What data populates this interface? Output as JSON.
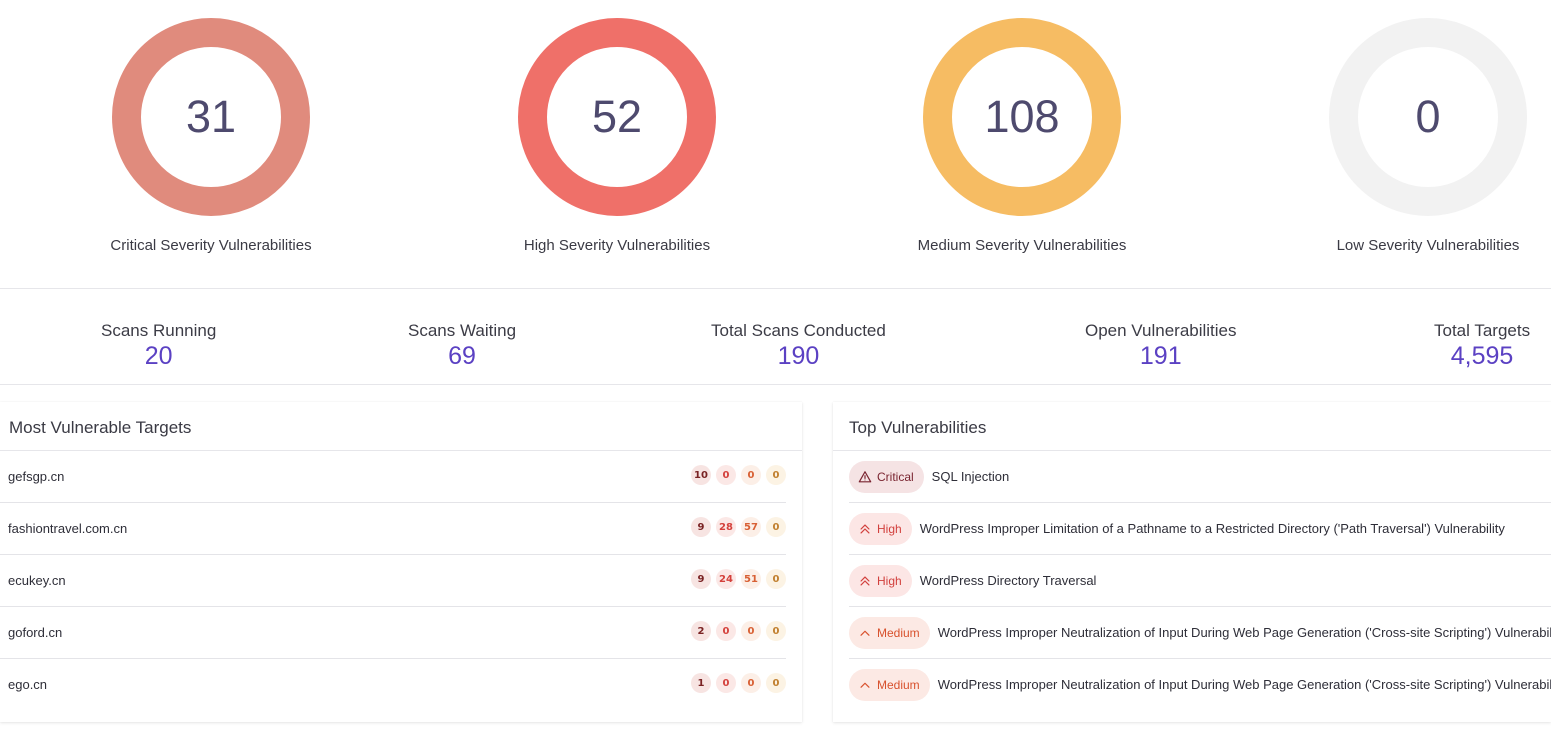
{
  "severity_cards": [
    {
      "value": "31",
      "label": "Critical Severity Vulnerabilities",
      "color": "#e08b7d"
    },
    {
      "value": "52",
      "label": "High Severity Vulnerabilities",
      "color": "#ef7069"
    },
    {
      "value": "108",
      "label": "Medium Severity Vulnerabilities",
      "color": "#f6bc63"
    },
    {
      "value": "0",
      "label": "Low Severity Vulnerabilities",
      "color": "#f2f2f2"
    }
  ],
  "stats": [
    {
      "label": "Scans Running",
      "value": "20"
    },
    {
      "label": "Scans Waiting",
      "value": "69"
    },
    {
      "label": "Total Scans Conducted",
      "value": "190"
    },
    {
      "label": "Open Vulnerabilities",
      "value": "191"
    },
    {
      "label": "Total Targets",
      "value": "4,595"
    }
  ],
  "most_vulnerable": {
    "title": "Most Vulnerable Targets",
    "rows": [
      {
        "name": "gefsgp.cn",
        "critical": "10",
        "high": "0",
        "medium": "0",
        "low": "0"
      },
      {
        "name": "fashiontravel.com.cn",
        "critical": "9",
        "high": "28",
        "medium": "57",
        "low": "0"
      },
      {
        "name": "ecukey.cn",
        "critical": "9",
        "high": "24",
        "medium": "51",
        "low": "0"
      },
      {
        "name": "goford.cn",
        "critical": "2",
        "high": "0",
        "medium": "0",
        "low": "0"
      },
      {
        "name": "ego.cn",
        "critical": "1",
        "high": "0",
        "medium": "0",
        "low": "0"
      }
    ]
  },
  "top_vulnerabilities": {
    "title": "Top Vulnerabilities",
    "rows": [
      {
        "severity": "Critical",
        "icon": "warning-triangle-icon",
        "name": "SQL Injection"
      },
      {
        "severity": "High",
        "icon": "double-chevron-up-icon",
        "name": "WordPress Improper Limitation of a Pathname to a Restricted Directory ('Path Traversal') Vulnerability"
      },
      {
        "severity": "High",
        "icon": "double-chevron-up-icon",
        "name": "WordPress Directory Traversal"
      },
      {
        "severity": "Medium",
        "icon": "chevron-up-icon",
        "name": "WordPress Improper Neutralization of Input During Web Page Generation ('Cross-site Scripting') Vulnerability"
      },
      {
        "severity": "Medium",
        "icon": "chevron-up-icon",
        "name": "WordPress Improper Neutralization of Input During Web Page Generation ('Cross-site Scripting') Vulnerability"
      }
    ]
  }
}
